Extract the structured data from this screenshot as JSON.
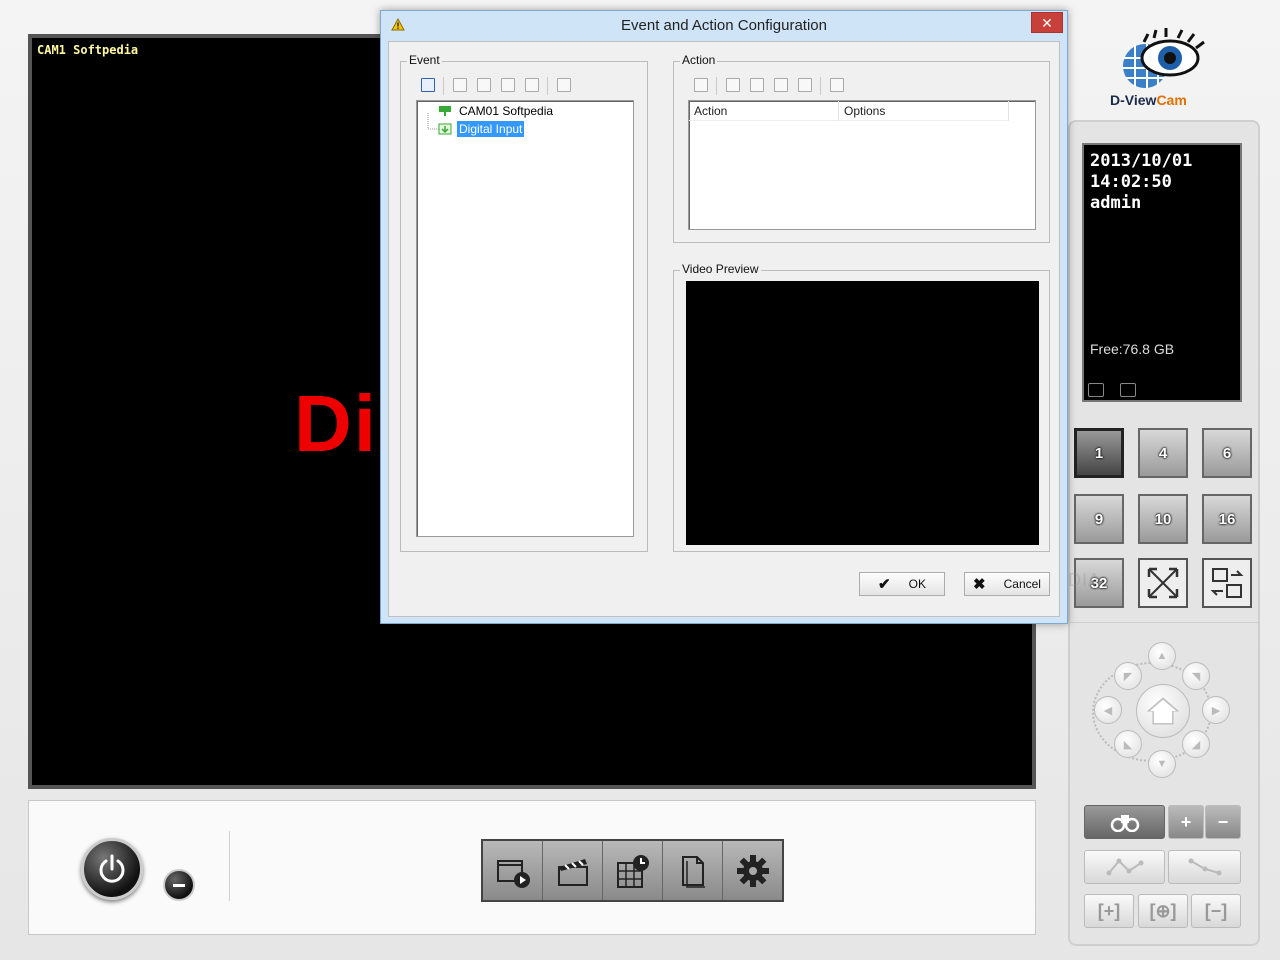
{
  "video": {
    "camera_label": "CAM1 Softpedia",
    "overlay_text": "Di"
  },
  "bottom_toolbar": {
    "buttons": [
      "playback-icon",
      "clapboard-icon",
      "schedule-icon",
      "document-icon",
      "gear-icon"
    ]
  },
  "logo": {
    "text_main": "D-View",
    "text_accent": "Cam"
  },
  "info": {
    "date": "2013/10/01",
    "time": "14:02:50",
    "user": "admin",
    "free_space": "Free:76.8 GB"
  },
  "split_buttons": {
    "labels": [
      "1",
      "4",
      "6",
      "9",
      "10",
      "16",
      "32"
    ]
  },
  "dialog": {
    "title": "Event and Action Configuration",
    "close_label": "✕",
    "event_group_label": "Event",
    "action_group_label": "Action",
    "preview_group_label": "Video Preview",
    "tree": {
      "camera": "CAM01 Softpedia",
      "input": "Digital Input"
    },
    "action_columns": [
      "Action",
      "Options"
    ],
    "ok_label": "OK",
    "cancel_label": "Cancel"
  },
  "watermark": "SOFTPEDIA",
  "colors": {
    "selection": "#3399ff",
    "close_button": "#c7403a",
    "overlay_text": "#ee0000",
    "camera_label": "#fff7a0"
  }
}
